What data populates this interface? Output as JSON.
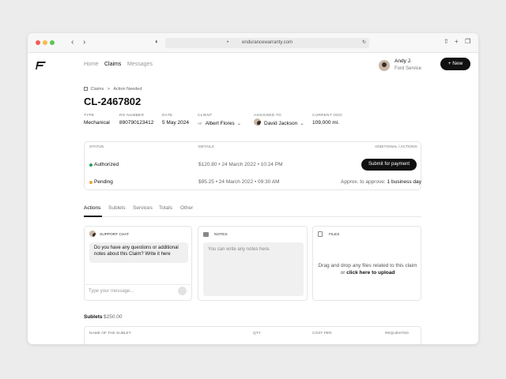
{
  "browser": {
    "url": "endurancewarranty.com"
  },
  "nav": {
    "items": [
      "Home",
      "Claims",
      "Messages"
    ],
    "active": "Claims"
  },
  "user": {
    "name": "Andy J.",
    "org": "Ford Service"
  },
  "new_button": "New",
  "breadcrumb": {
    "root": "Claims",
    "separator": ">",
    "current": "Action Needed"
  },
  "claim": {
    "id": "CL-2467802",
    "fields": [
      {
        "label": "TYPE",
        "value": "Mechanical"
      },
      {
        "label": "RO NUMBER",
        "value": "890790123412"
      },
      {
        "label": "DATE",
        "value": "5 May 2024"
      },
      {
        "label": "CLIENT",
        "value": "Albert Flores"
      },
      {
        "label": "ASSIGNED TO",
        "value": "David Jackson"
      },
      {
        "label": "CURRENT ODO",
        "value": "109,000 mi."
      }
    ]
  },
  "status_table": {
    "headers": {
      "status": "STATUS",
      "details": "DETAILS",
      "actions": "ADDITIONAL / ACTIONS"
    },
    "rows": [
      {
        "status": "Authorized",
        "color": "#2e9e5b",
        "amount": "$120.80",
        "date": "24 March 2022",
        "time": "10:24 PM",
        "action_button": "Submit for payment"
      },
      {
        "status": "Pending",
        "color": "#f2a33a",
        "amount": "$95.25",
        "date": "24 March 2022",
        "time": "09:30 AM",
        "approve_label": "Approx. to approve:",
        "approve_value": "1 business day"
      }
    ]
  },
  "tabs": [
    "Actions",
    "Sublets",
    "Services",
    "Totals",
    "Other"
  ],
  "active_tab": "Actions",
  "panels": {
    "chat": {
      "title": "SUPPORT CHAT",
      "message": "Do you have any questions or additional notes about this Claim? Write it here",
      "input_placeholder": "Type your message..."
    },
    "notes": {
      "title": "NOTES",
      "placeholder": "You can write any notes here."
    },
    "files": {
      "title": "FILES",
      "text": "Drag and drop any files related to this claim or",
      "link": "click here to upload"
    }
  },
  "sublets": {
    "title": "Sublets",
    "amount": "$250.00",
    "columns": [
      "NAME OF THE SUBLET",
      "QTY",
      "COST PER",
      "REQUESTED"
    ]
  }
}
